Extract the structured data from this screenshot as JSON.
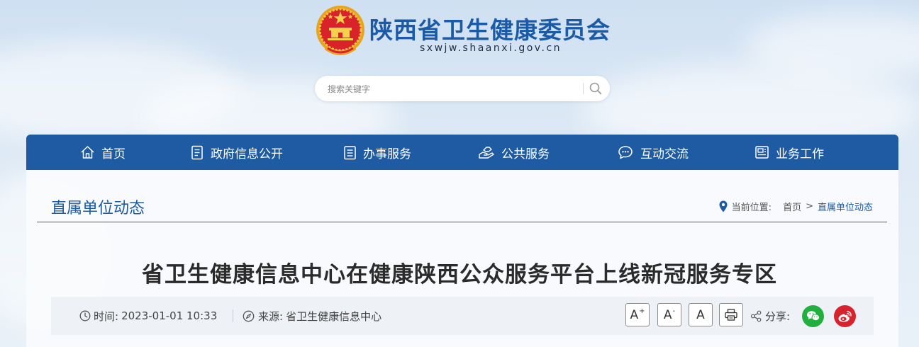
{
  "header": {
    "site_name": "陕西省卫生健康委员会",
    "site_url": "sxwjw.shaanxi.gov.cn",
    "search_placeholder": "搜索关键字"
  },
  "nav": {
    "items": [
      {
        "label": "首页",
        "icon": "home-icon"
      },
      {
        "label": "政府信息公开",
        "icon": "document-list-icon"
      },
      {
        "label": "办事服务",
        "icon": "clipboard-icon"
      },
      {
        "label": "公共服务",
        "icon": "hands-service-icon"
      },
      {
        "label": "互动交流",
        "icon": "chat-bubbles-icon"
      },
      {
        "label": "业务工作",
        "icon": "briefcase-doc-icon"
      }
    ]
  },
  "section": {
    "title": "直属单位动态",
    "breadcrumb": {
      "label": "当前位置:",
      "items": [
        "首页",
        "直属单位动态"
      ],
      "separator": ">"
    }
  },
  "article": {
    "title": "省卫生健康信息中心在健康陕西公众服务平台上线新冠服务专区",
    "time_label": "时间:",
    "time_value": "2023-01-01 10:33",
    "source_label": "来源:",
    "source_value": "省卫生健康信息中心",
    "font_buttons": {
      "increase": "A",
      "decrease": "A",
      "reset": "A",
      "increase_sup": "+",
      "decrease_sup": "-"
    },
    "share_label": "分享:"
  },
  "colors": {
    "brand_blue": "#1e5ba2",
    "wechat_green": "#21b03e",
    "weibo_red": "#d6242f"
  }
}
